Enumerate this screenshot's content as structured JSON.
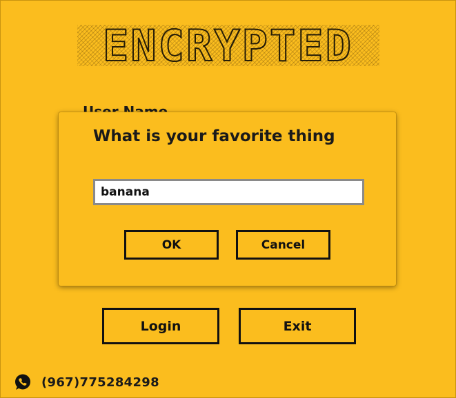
{
  "app": {
    "logo_text": "ENCRYPTED"
  },
  "form": {
    "username_label": "User Name",
    "login_label": "Login",
    "exit_label": "Exit"
  },
  "dialog": {
    "title": "What is your favorite thing",
    "input_value": "banana",
    "ok_label": "OK",
    "cancel_label": "Cancel"
  },
  "contact": {
    "icon": "whatsapp-icon",
    "phone": "(967)775284298"
  },
  "colors": {
    "background": "#fbbd1e",
    "text": "#1a1a1a",
    "input_border": "#8a8a8a"
  }
}
